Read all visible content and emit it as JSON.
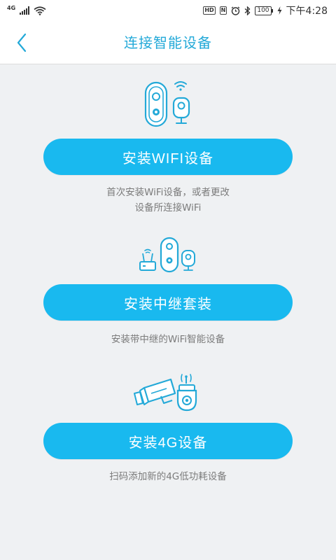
{
  "status_bar": {
    "network": "4G",
    "hd_badge": "HD",
    "nfc_badge": "N",
    "battery": "100",
    "time": "下午4:28"
  },
  "header": {
    "title": "连接智能设备"
  },
  "options": [
    {
      "button_label": "安装WIFI设备",
      "description_lines": [
        "首次安装WiFi设备，或者更改",
        "设备所连接WiFi"
      ]
    },
    {
      "button_label": "安装中继套装",
      "description_lines": [
        "安装带中继的WiFi智能设备"
      ]
    },
    {
      "button_label": "安装4G设备",
      "description_lines": [
        "扫码添加新的4G低功耗设备"
      ]
    }
  ],
  "colors": {
    "accent": "#19b9ef",
    "title": "#23a9d8",
    "background": "#eff1f3",
    "description": "#7b7b7b"
  },
  "icons": {
    "back": "chevron-left-icon",
    "wifi_device": "doorbell-camera-wifi-icon",
    "relay_kit": "router-doorbell-camera-icon",
    "device_4g": "cctv-camera-4g-icon"
  }
}
